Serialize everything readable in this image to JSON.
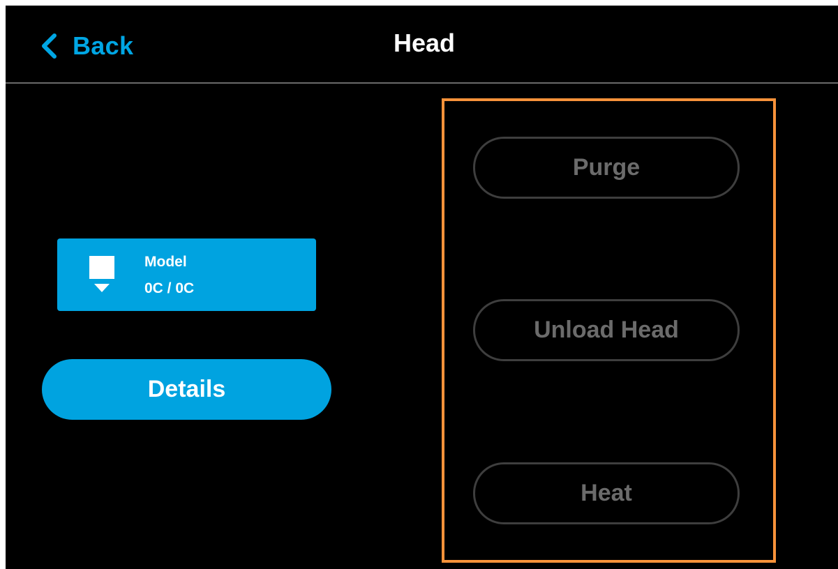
{
  "header": {
    "back_label": "Back",
    "title": "Head",
    "back_icon": "chevron-left-icon"
  },
  "head_card": {
    "icon": "nozzle-icon",
    "name": "Model",
    "temperature": "0C / 0C"
  },
  "details_button": {
    "label": "Details"
  },
  "actions": {
    "purge_label": "Purge",
    "unload_label": "Unload Head",
    "heat_label": "Heat",
    "state": "disabled"
  },
  "colors": {
    "accent": "#00a3e0",
    "background": "#000000",
    "highlight": "#f7923a",
    "disabled_text": "#6b6b6b",
    "disabled_border": "#3e3e3e"
  }
}
